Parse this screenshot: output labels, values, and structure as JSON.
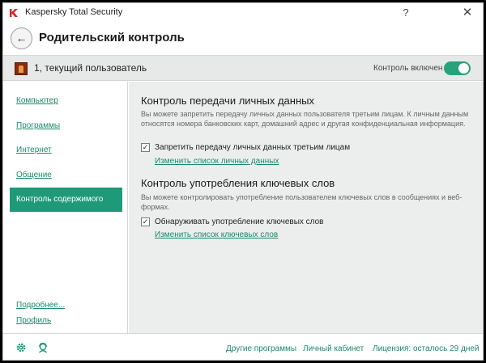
{
  "window": {
    "app_title": "Kaspersky Total Security",
    "help_glyph": "?",
    "close_glyph": "✕"
  },
  "header": {
    "back_glyph": "←",
    "page_title": "Родительский контроль"
  },
  "userbar": {
    "user_name": "1, текущий пользователь",
    "control_label": "Контроль включен",
    "control_enabled": true
  },
  "sidebar": {
    "items": [
      {
        "label": "Компьютер"
      },
      {
        "label": "Программы"
      },
      {
        "label": "Интернет"
      },
      {
        "label": "Общение"
      },
      {
        "label": "Контроль содержимого",
        "active": true
      }
    ],
    "more_link": "Подробнее...",
    "profile_link": "Профиль"
  },
  "main": {
    "sections": [
      {
        "title": "Контроль передачи личных данных",
        "description": "Вы можете запретить передачу личных данных пользователя третьим лицам. К личным данным относятся номера банковских карт, домашний адрес и другая конфиденциальная информация.",
        "checkbox_label": "Запретить передачу личных данных третьим лицам",
        "checked": true,
        "edit_link": "Изменить список личных данных"
      },
      {
        "title": "Контроль употребления ключевых слов",
        "description": "Вы можете контролировать употребление пользователем ключевых слов в сообщениях и веб-формах.",
        "checkbox_label": "Обнаруживать употребление ключевых слов",
        "checked": true,
        "edit_link": "Изменить список ключевых слов"
      }
    ],
    "check_glyph": "✓"
  },
  "footer": {
    "other_programs": "Другие программы",
    "account": "Личный кабинет",
    "license": "Лицензия: осталось 29 дней"
  },
  "colors": {
    "accent": "#1f9a78",
    "link": "#1b8a6a",
    "toggle_on": "#28a17c"
  }
}
